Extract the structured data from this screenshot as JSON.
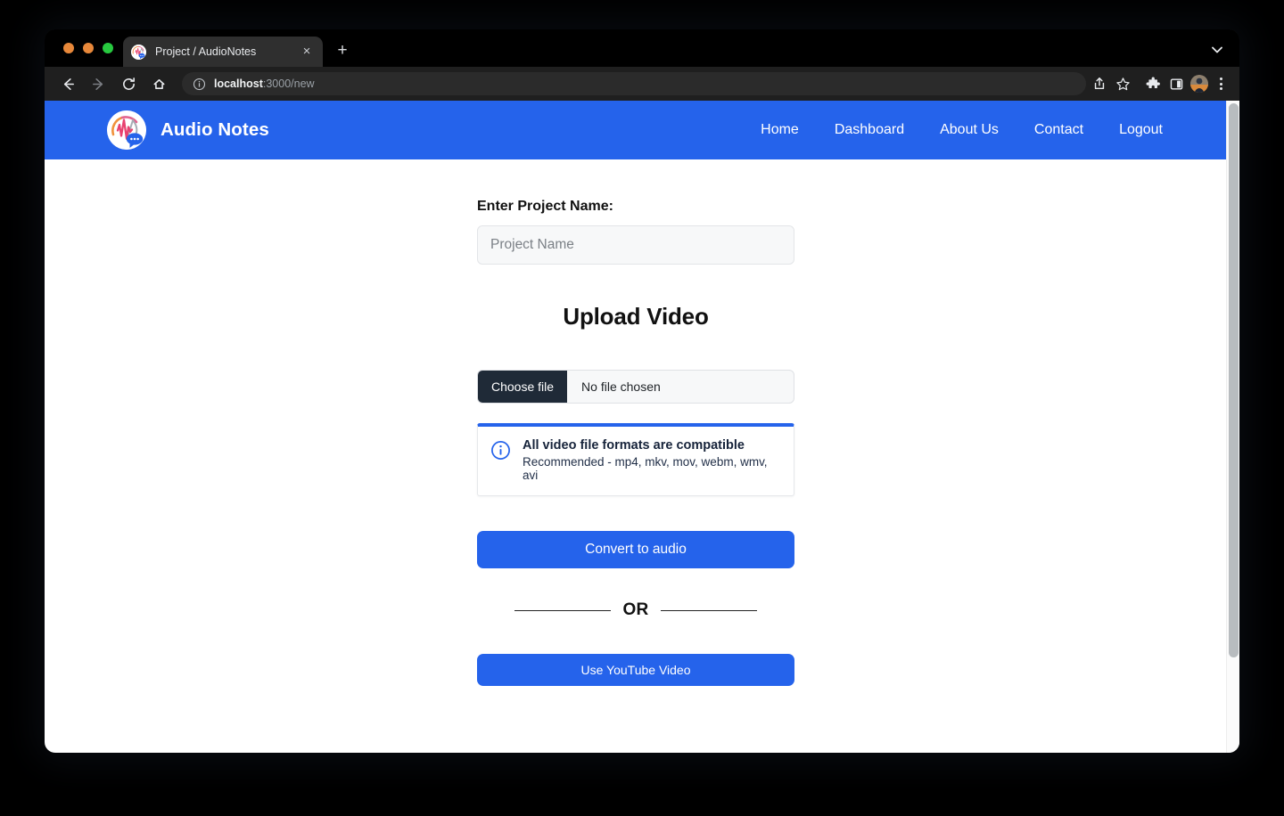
{
  "browser": {
    "tab": {
      "title": "Project / AudioNotes",
      "close_label": "×",
      "favicon_name": "audionotes-favicon"
    },
    "new_tab_label": "+",
    "tab_list_label": "tab-list-chevron",
    "toolbar": {
      "back_label": "←",
      "forward_label": "→",
      "reload_label": "⟳",
      "home_label": "⌂",
      "url_host": "localhost",
      "url_path": ":3000/new",
      "share_label": "share-icon",
      "bookmark_label": "star-icon",
      "extensions_label": "puzzle-icon",
      "side_panel_label": "side-panel-icon",
      "profile_label": "profile-avatar",
      "menu_label": "three-dot-menu"
    }
  },
  "navbar": {
    "brand": "Audio Notes",
    "links": [
      {
        "label": "Home"
      },
      {
        "label": "Dashboard"
      },
      {
        "label": "About Us"
      },
      {
        "label": "Contact"
      },
      {
        "label": "Logout"
      }
    ]
  },
  "form": {
    "project_name_label": "Enter Project Name:",
    "project_name_value": "",
    "project_name_placeholder": "Project Name",
    "upload_heading": "Upload Video",
    "choose_file_label": "Choose file",
    "file_name_label": "No file chosen",
    "alert": {
      "title": "All video file formats are compatible",
      "subtitle": "Recommended - mp4, mkv, mov, webm, wmv, avi"
    },
    "convert_button_label": "Convert to audio",
    "or_label": "OR",
    "youtube_button_label": "Use YouTube Video"
  },
  "colors": {
    "brand_blue": "#2563eb",
    "dark_button": "#1f2a37",
    "alert_accent": "#2563eb",
    "page_background": "#ffffff"
  }
}
